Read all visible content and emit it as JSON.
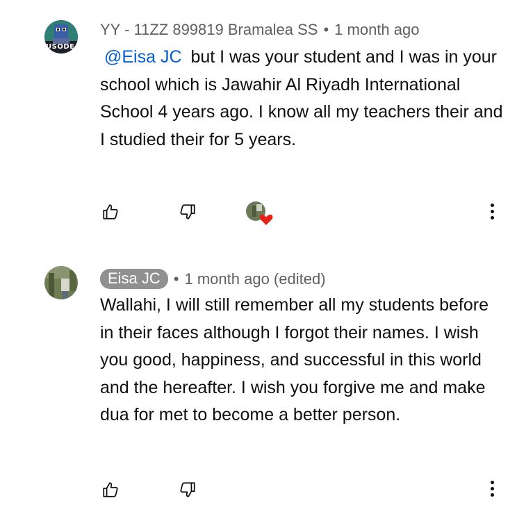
{
  "comments": [
    {
      "author": "YY - 11ZZ 899819 Bramalea SS",
      "time": "1 month ago",
      "mention": "@Eisa JC",
      "text": "but I was your student and I was in your school which is Jawahir Al Riyadh International School 4 years ago. I know all my teachers their and I studied their for 5 years.",
      "avatar_label": "USODE",
      "has_creator_heart": true
    },
    {
      "author": "Eisa JC",
      "time": "1 month ago (edited)",
      "text": "Wallahi, I will still remember all my students before in their faces although I forgot their names. I wish you good, happiness, and successful in this world and the hereafter. I wish you forgive me and make dua for met to become a better person."
    }
  ],
  "separator": "•",
  "icons": {
    "like": "thumbs-up-icon",
    "dislike": "thumbs-down-icon",
    "heart": "creator-heart-icon",
    "more": "more-vert-icon"
  },
  "colors": {
    "mention": "#065fd4",
    "meta": "#606060",
    "chip": "#909090",
    "heart": "#e62117"
  }
}
